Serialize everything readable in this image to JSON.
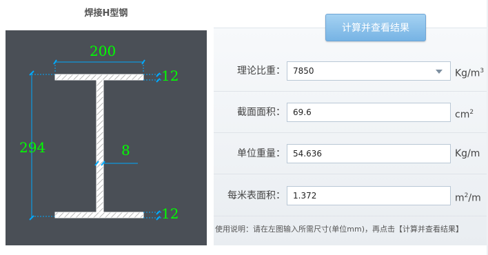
{
  "left_title": "焊接H型钢",
  "dimensions": {
    "width": "200",
    "flange_top": "12",
    "height": "294",
    "web": "8",
    "flange_bottom": "12"
  },
  "calc_button": "计算并查看结果",
  "fields": {
    "density": {
      "label": "理论比重：",
      "value": "7850",
      "unit": "Kg/m",
      "unit_sup": "3"
    },
    "area": {
      "label": "截面面积：",
      "value": "69.6",
      "unit": "cm",
      "unit_sup": "2"
    },
    "unit_weight": {
      "label": "单位重量：",
      "value": "54.636",
      "unit": "Kg/m"
    },
    "surface_area": {
      "label": "每米表面积：",
      "value": "1.372",
      "unit": "m",
      "unit_sup": "2",
      "unit_tail": "/m"
    }
  },
  "usage_note": "使用说明：请在左图输入所需尺寸(单位mm)，再点击【计算并查看结果】",
  "colors": {
    "diagram_bg": "#4a4f56",
    "dim_text": "#00ff00",
    "button": "#76b3e4"
  }
}
